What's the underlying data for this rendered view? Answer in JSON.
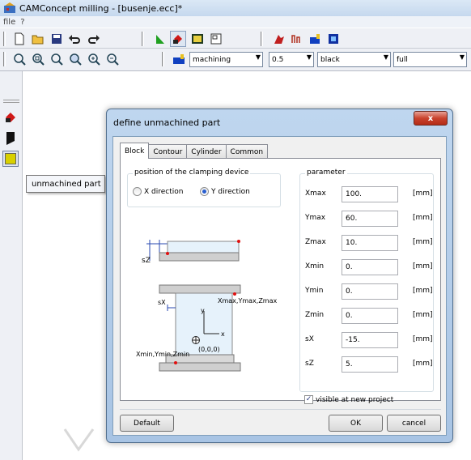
{
  "window": {
    "title": "CAMConcept milling - [busenje.ecc]*"
  },
  "menu": {
    "items": [
      "file",
      "?"
    ]
  },
  "toolbar": {
    "mode_select": "machining",
    "size_select": "0.5",
    "color_select": "black",
    "view_select": "full"
  },
  "tooltip": {
    "text": "unmachined part"
  },
  "dialog": {
    "title": "define unmachined part",
    "close_label": "x",
    "tabs": [
      "Block",
      "Contour",
      "Cylinder",
      "Common"
    ],
    "active_tab": "Block",
    "clamping": {
      "group_label": "position of the clamping device",
      "x_label": "X direction",
      "y_label": "Y direction",
      "selected": "Y direction"
    },
    "diagram": {
      "sz": "sZ",
      "sx": "sX",
      "max_label": "Xmax,Ymax,Zmax",
      "min_label": "Xmin,Ymin,Zmin",
      "origin": "(0,0,0)",
      "axis_y": "y",
      "axis_x": "x"
    },
    "parameter": {
      "group_label": "parameter",
      "unit": "[mm]",
      "rows": [
        {
          "label": "Xmax",
          "value": "100."
        },
        {
          "label": "Ymax",
          "value": "60."
        },
        {
          "label": "Zmax",
          "value": "10."
        },
        {
          "label": "Xmin",
          "value": "0."
        },
        {
          "label": "Ymin",
          "value": "0."
        },
        {
          "label": "Zmin",
          "value": "0."
        },
        {
          "label": "sX",
          "value": "-15."
        },
        {
          "label": "sZ",
          "value": "5."
        }
      ]
    },
    "visible_checkbox": {
      "label": "visible at new project",
      "checked": true
    },
    "buttons": {
      "default": "Default",
      "ok": "OK",
      "cancel": "cancel"
    }
  }
}
